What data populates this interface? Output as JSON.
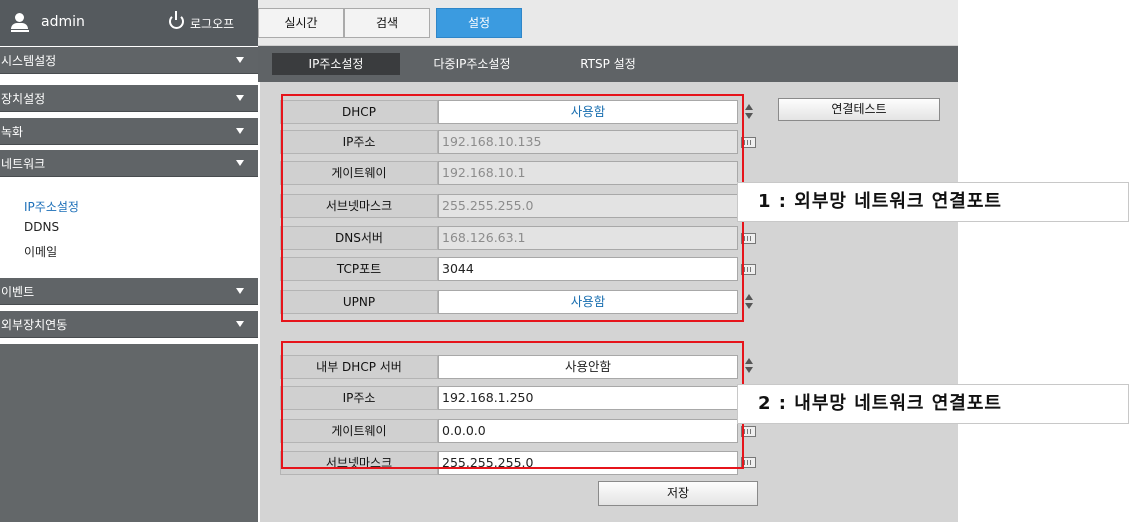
{
  "user": {
    "name": "admin",
    "logout_label": "로그오프"
  },
  "sidebar": {
    "menus": [
      {
        "label": "시스템설정"
      },
      {
        "label": "장치설정"
      },
      {
        "label": "녹화"
      },
      {
        "label": "네트워크"
      },
      {
        "label": "이벤트"
      },
      {
        "label": "외부장치연동"
      }
    ],
    "network_subitems": [
      {
        "label": "IP주소설정",
        "active": true
      },
      {
        "label": "DDNS",
        "active": false
      },
      {
        "label": "이메일",
        "active": false
      }
    ]
  },
  "tabs": [
    {
      "label": "실시간",
      "active": false
    },
    {
      "label": "검색",
      "active": false
    },
    {
      "label": "설정",
      "active": true
    }
  ],
  "subtabs": [
    {
      "label": "IP주소설정",
      "active": true
    },
    {
      "label": "다중IP주소설정",
      "active": false
    },
    {
      "label": "RTSP 설정",
      "active": false
    }
  ],
  "external": {
    "dhcp": {
      "label": "DHCP",
      "value": "사용함"
    },
    "ip": {
      "label": "IP주소",
      "value": "192.168.10.135"
    },
    "gateway": {
      "label": "게이트웨이",
      "value": "192.168.10.1"
    },
    "subnet": {
      "label": "서브넷마스크",
      "value": "255.255.255.0"
    },
    "dns": {
      "label": "DNS서버",
      "value": "168.126.63.1"
    },
    "tcp_port": {
      "label": "TCP포트",
      "value": "3044"
    },
    "upnp": {
      "label": "UPNP",
      "value": "사용함"
    }
  },
  "internal": {
    "dhcp_server": {
      "label": "내부 DHCP 서버",
      "value": "사용안함"
    },
    "ip": {
      "label": "IP주소",
      "value": "192.168.1.250"
    },
    "gateway": {
      "label": "게이트웨이",
      "value": "0.0.0.0"
    },
    "subnet": {
      "label": "서브넷마스크",
      "value": "255.255.255.0"
    }
  },
  "buttons": {
    "connection_test": "연결테스트",
    "save": "저장"
  },
  "annotations": {
    "external_port": "1 : 외부망 네트워크 연결포트",
    "internal_port": "2 : 내부망 네트워크 연결포트"
  },
  "colors": {
    "accent": "#3b9be0",
    "highlight": "#e6141b",
    "value_blue": "#1a6fb0"
  }
}
